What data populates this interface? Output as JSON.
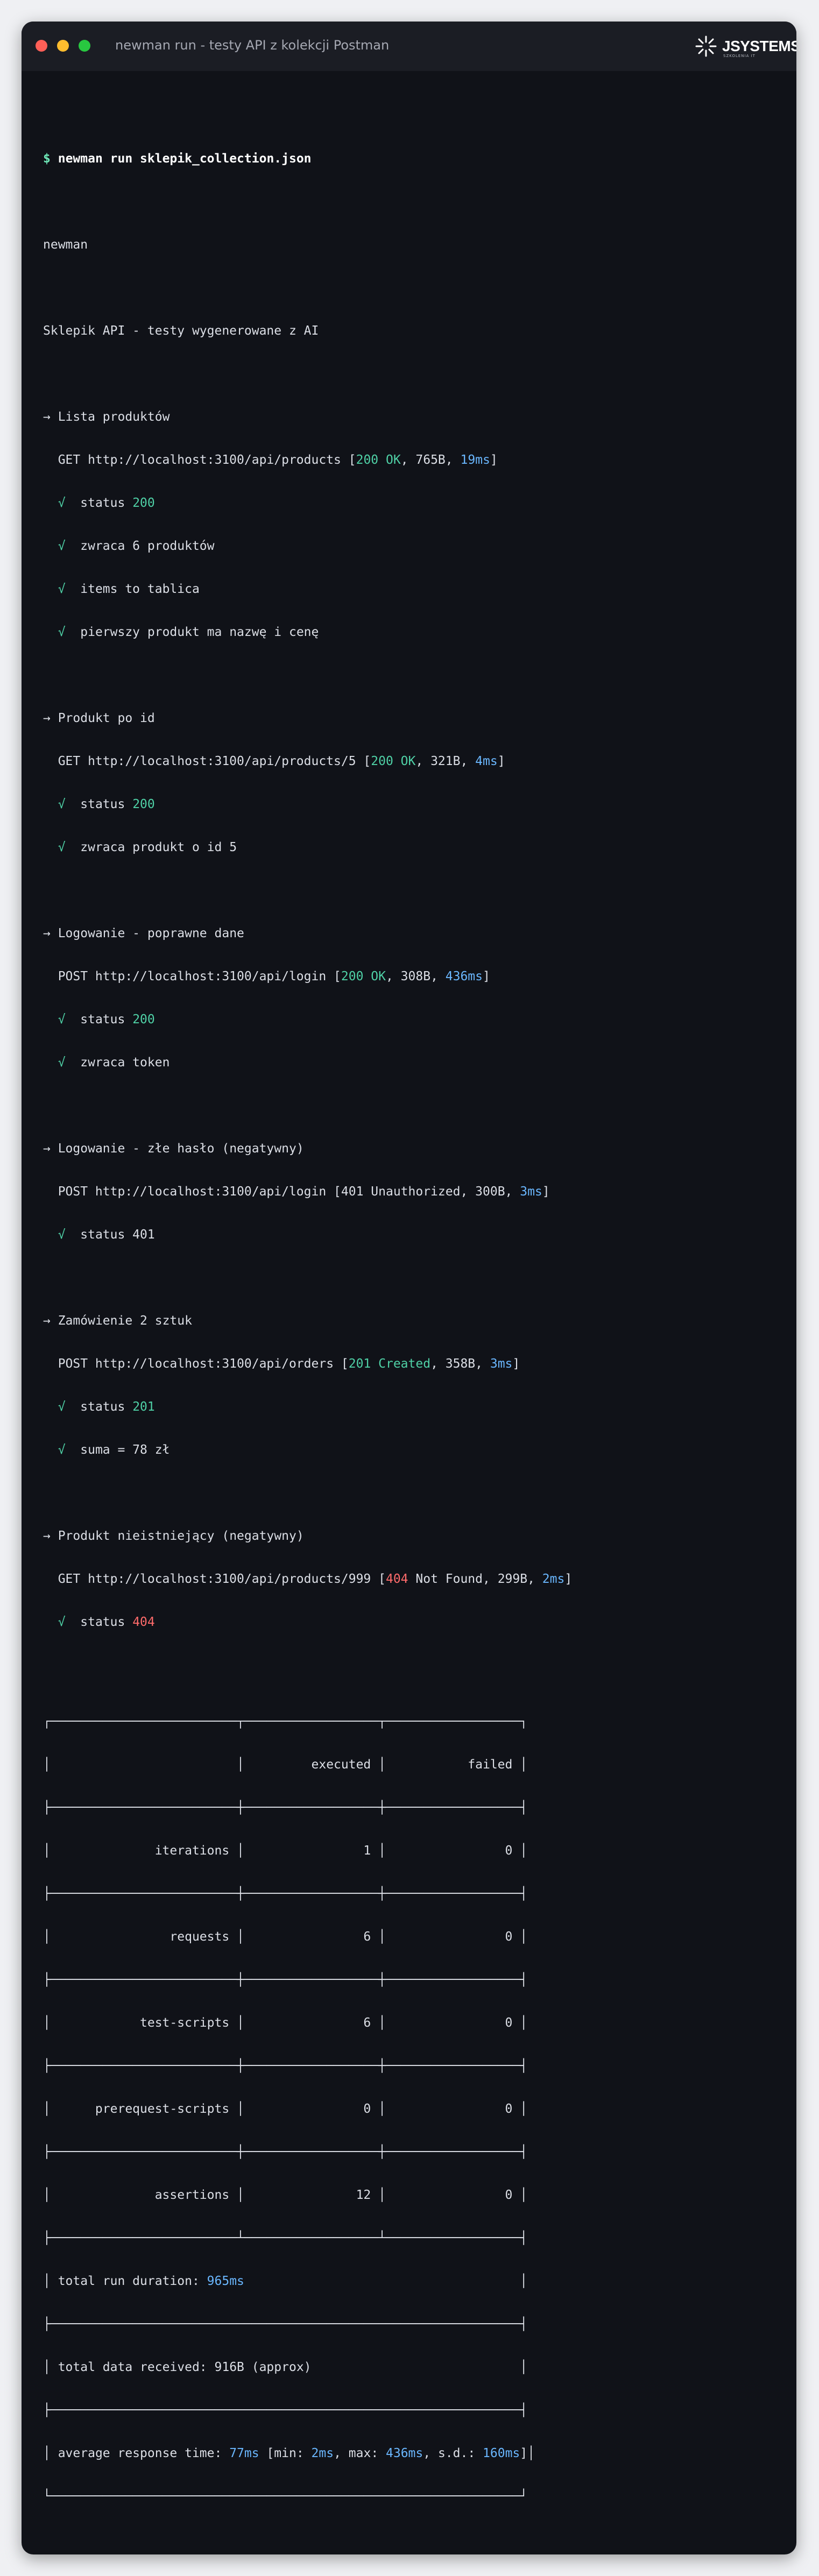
{
  "window": {
    "title": "newman run - testy API z kolekcji Postman",
    "logo_text": "JSYSTEMS",
    "logo_tagline": "SZKOLENIA IT"
  },
  "terminal": {
    "prompt": "$",
    "command": "newman run sklepik_collection.json",
    "tool": "newman",
    "collection": "Sklepik API - testy wygenerowane z AI",
    "check_mark": "√",
    "arrow": "→",
    "requests": [
      {
        "name": "Lista produktów",
        "method": "GET",
        "url": "http://localhost:3100/api/products",
        "status_code": "200",
        "status_text": "OK",
        "size": "765B",
        "time": "19ms",
        "assertions": [
          {
            "text": "status ",
            "value": "200",
            "value_color": "green"
          },
          {
            "text": "zwraca 6 produktów",
            "value": "",
            "value_color": ""
          },
          {
            "text": "items to tablica",
            "value": "",
            "value_color": ""
          },
          {
            "text": "pierwszy produkt ma nazwę i cenę",
            "value": "",
            "value_color": ""
          }
        ]
      },
      {
        "name": "Produkt po id",
        "method": "GET",
        "url": "http://localhost:3100/api/products/5",
        "status_code": "200",
        "status_text": "OK",
        "size": "321B",
        "time": "4ms",
        "assertions": [
          {
            "text": "status ",
            "value": "200",
            "value_color": "green"
          },
          {
            "text": "zwraca produkt o id 5",
            "value": "",
            "value_color": ""
          }
        ]
      },
      {
        "name": "Logowanie - poprawne dane",
        "method": "POST",
        "url": "http://localhost:3100/api/login",
        "status_code": "200",
        "status_text": "OK",
        "size": "308B",
        "time": "436ms",
        "assertions": [
          {
            "text": "status ",
            "value": "200",
            "value_color": "green"
          },
          {
            "text": "zwraca token",
            "value": "",
            "value_color": ""
          }
        ]
      },
      {
        "name": "Logowanie - złe hasło (negatywny)",
        "method": "POST",
        "url": "http://localhost:3100/api/login",
        "status_code": "401",
        "status_text": "Unauthorized",
        "size": "300B",
        "time": "3ms",
        "assertions": [
          {
            "text": "status 401",
            "value": "",
            "value_color": ""
          }
        ]
      },
      {
        "name": "Zamówienie 2 sztuk",
        "method": "POST",
        "url": "http://localhost:3100/api/orders",
        "status_code": "201",
        "status_text": "Created",
        "size": "358B",
        "time": "3ms",
        "assertions": [
          {
            "text": "status ",
            "value": "201",
            "value_color": "green"
          },
          {
            "text": "suma = 78 zł",
            "value": "",
            "value_color": ""
          }
        ]
      },
      {
        "name": "Produkt nieistniejący (negatywny)",
        "method": "GET",
        "url": "http://localhost:3100/api/products/999",
        "status_code": "404",
        "status_text": "Not Found",
        "size": "299B",
        "time": "2ms",
        "assertions": [
          {
            "text": "status ",
            "value": "404",
            "value_color": "red"
          }
        ]
      }
    ],
    "summary": {
      "headers": [
        "",
        "executed",
        "failed"
      ],
      "rows": [
        {
          "label": "iterations",
          "executed": "1",
          "failed": "0"
        },
        {
          "label": "requests",
          "executed": "6",
          "failed": "0"
        },
        {
          "label": "test-scripts",
          "executed": "6",
          "failed": "0"
        },
        {
          "label": "prerequest-scripts",
          "executed": "0",
          "failed": "0"
        },
        {
          "label": "assertions",
          "executed": "12",
          "failed": "0"
        }
      ],
      "duration_label": "total run duration: ",
      "duration": "965ms",
      "data_label": "total data received: 916B (approx)",
      "avg_label": "average response time: ",
      "avg": "77ms",
      "min": "2ms",
      "max": "436ms",
      "sd": "160ms"
    }
  }
}
